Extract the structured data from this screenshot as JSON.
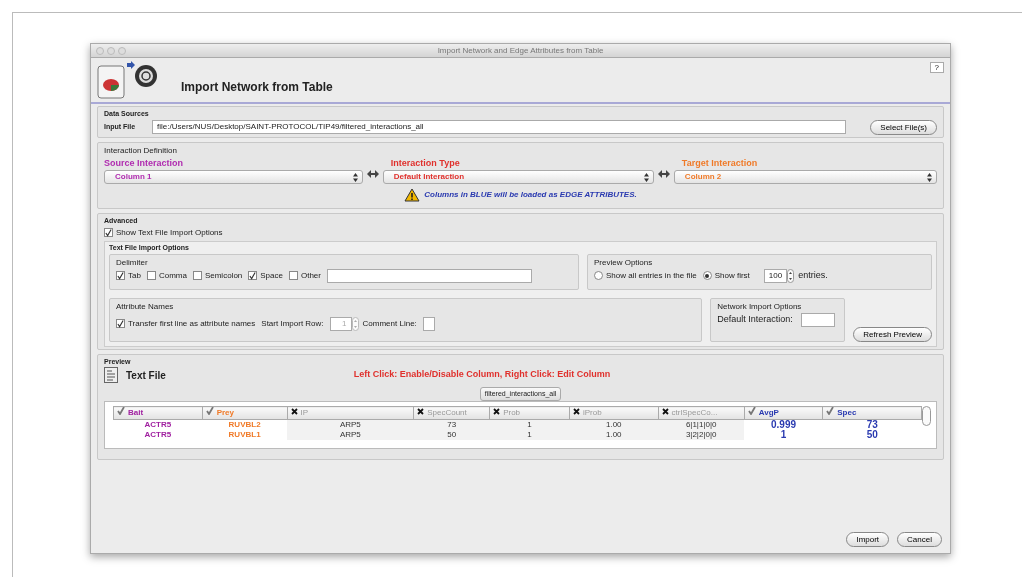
{
  "window": {
    "title": "Import Network and Edge Attributes from Table",
    "help": "?"
  },
  "header": {
    "title": "Import Network from Table"
  },
  "data_sources": {
    "legend": "Data Sources",
    "input_label": "Input File",
    "input_value": "file:/Users/NUS/Desktop/SAINT-PROTOCOL/TIP49/filtered_interactions_all",
    "button": "Select File(s)"
  },
  "interaction": {
    "legend": "Interaction Definition",
    "selectors": [
      {
        "label": "Source Interaction",
        "value": "Column 1",
        "color": "#b02cb0"
      },
      {
        "label": "Interaction Type",
        "value": "Default Interaction",
        "color": "#e0302c"
      },
      {
        "label": "Target Interaction",
        "value": "Column 2",
        "color": "#f07a28"
      }
    ],
    "note": "Columns in BLUE will be loaded as EDGE ATTRIBUTES."
  },
  "advanced": {
    "legend": "Advanced",
    "show_options": {
      "label": "Show Text File Import Options",
      "checked": true
    },
    "options_legend": "Text File Import Options",
    "delimiter": {
      "legend": "Delimiter",
      "options": [
        {
          "label": "Tab",
          "checked": true
        },
        {
          "label": "Comma",
          "checked": false
        },
        {
          "label": "Semicolon",
          "checked": false
        },
        {
          "label": "Space",
          "checked": true
        },
        {
          "label": "Other",
          "checked": false
        }
      ]
    },
    "preview_options": {
      "legend": "Preview Options",
      "radios": [
        {
          "label": "Show all entries in the file",
          "selected": false
        },
        {
          "label": "Show first",
          "selected": true
        }
      ],
      "count": "100",
      "suffix": "entries."
    },
    "attribute_names": {
      "legend": "Attribute Names",
      "transfer": {
        "label": "Transfer first line as attribute names",
        "checked": true
      },
      "start_row_label": "Start Import Row:",
      "start_row": "1",
      "comment_label": "Comment Line:"
    },
    "network_options": {
      "legend": "Network Import Options",
      "default_label": "Default Interaction:"
    },
    "refresh": "Refresh Preview"
  },
  "preview": {
    "legend": "Preview",
    "title": "Text File",
    "hint": "Left Click: Enable/Disable Column, Right Click: Edit Column",
    "tab": "filtered_interactions_all",
    "columns": [
      {
        "name": "Bait",
        "enabled": true,
        "color": "#a020a0"
      },
      {
        "name": "Prey",
        "enabled": true,
        "color": "#f07a28"
      },
      {
        "name": "IP",
        "enabled": false
      },
      {
        "name": "SpecCount",
        "enabled": false
      },
      {
        "name": "Prob",
        "enabled": false
      },
      {
        "name": "iProb",
        "enabled": false
      },
      {
        "name": "ctrlSpecCo...",
        "enabled": false
      },
      {
        "name": "AvgP",
        "enabled": true,
        "color": "#2a3ab0"
      },
      {
        "name": "Spec",
        "enabled": true,
        "color": "#2a3ab0"
      }
    ],
    "rows": [
      [
        "ACTR5",
        "RUVBL2",
        "ARP5",
        "73",
        "1",
        "1.00",
        "6|1|1|0|0",
        "0.999",
        "73"
      ],
      [
        "ACTR5",
        "RUVBL1",
        "ARP5",
        "50",
        "1",
        "1.00",
        "3|2|2|0|0",
        "1",
        "50"
      ]
    ]
  },
  "buttons": [
    "Import",
    "Cancel"
  ]
}
